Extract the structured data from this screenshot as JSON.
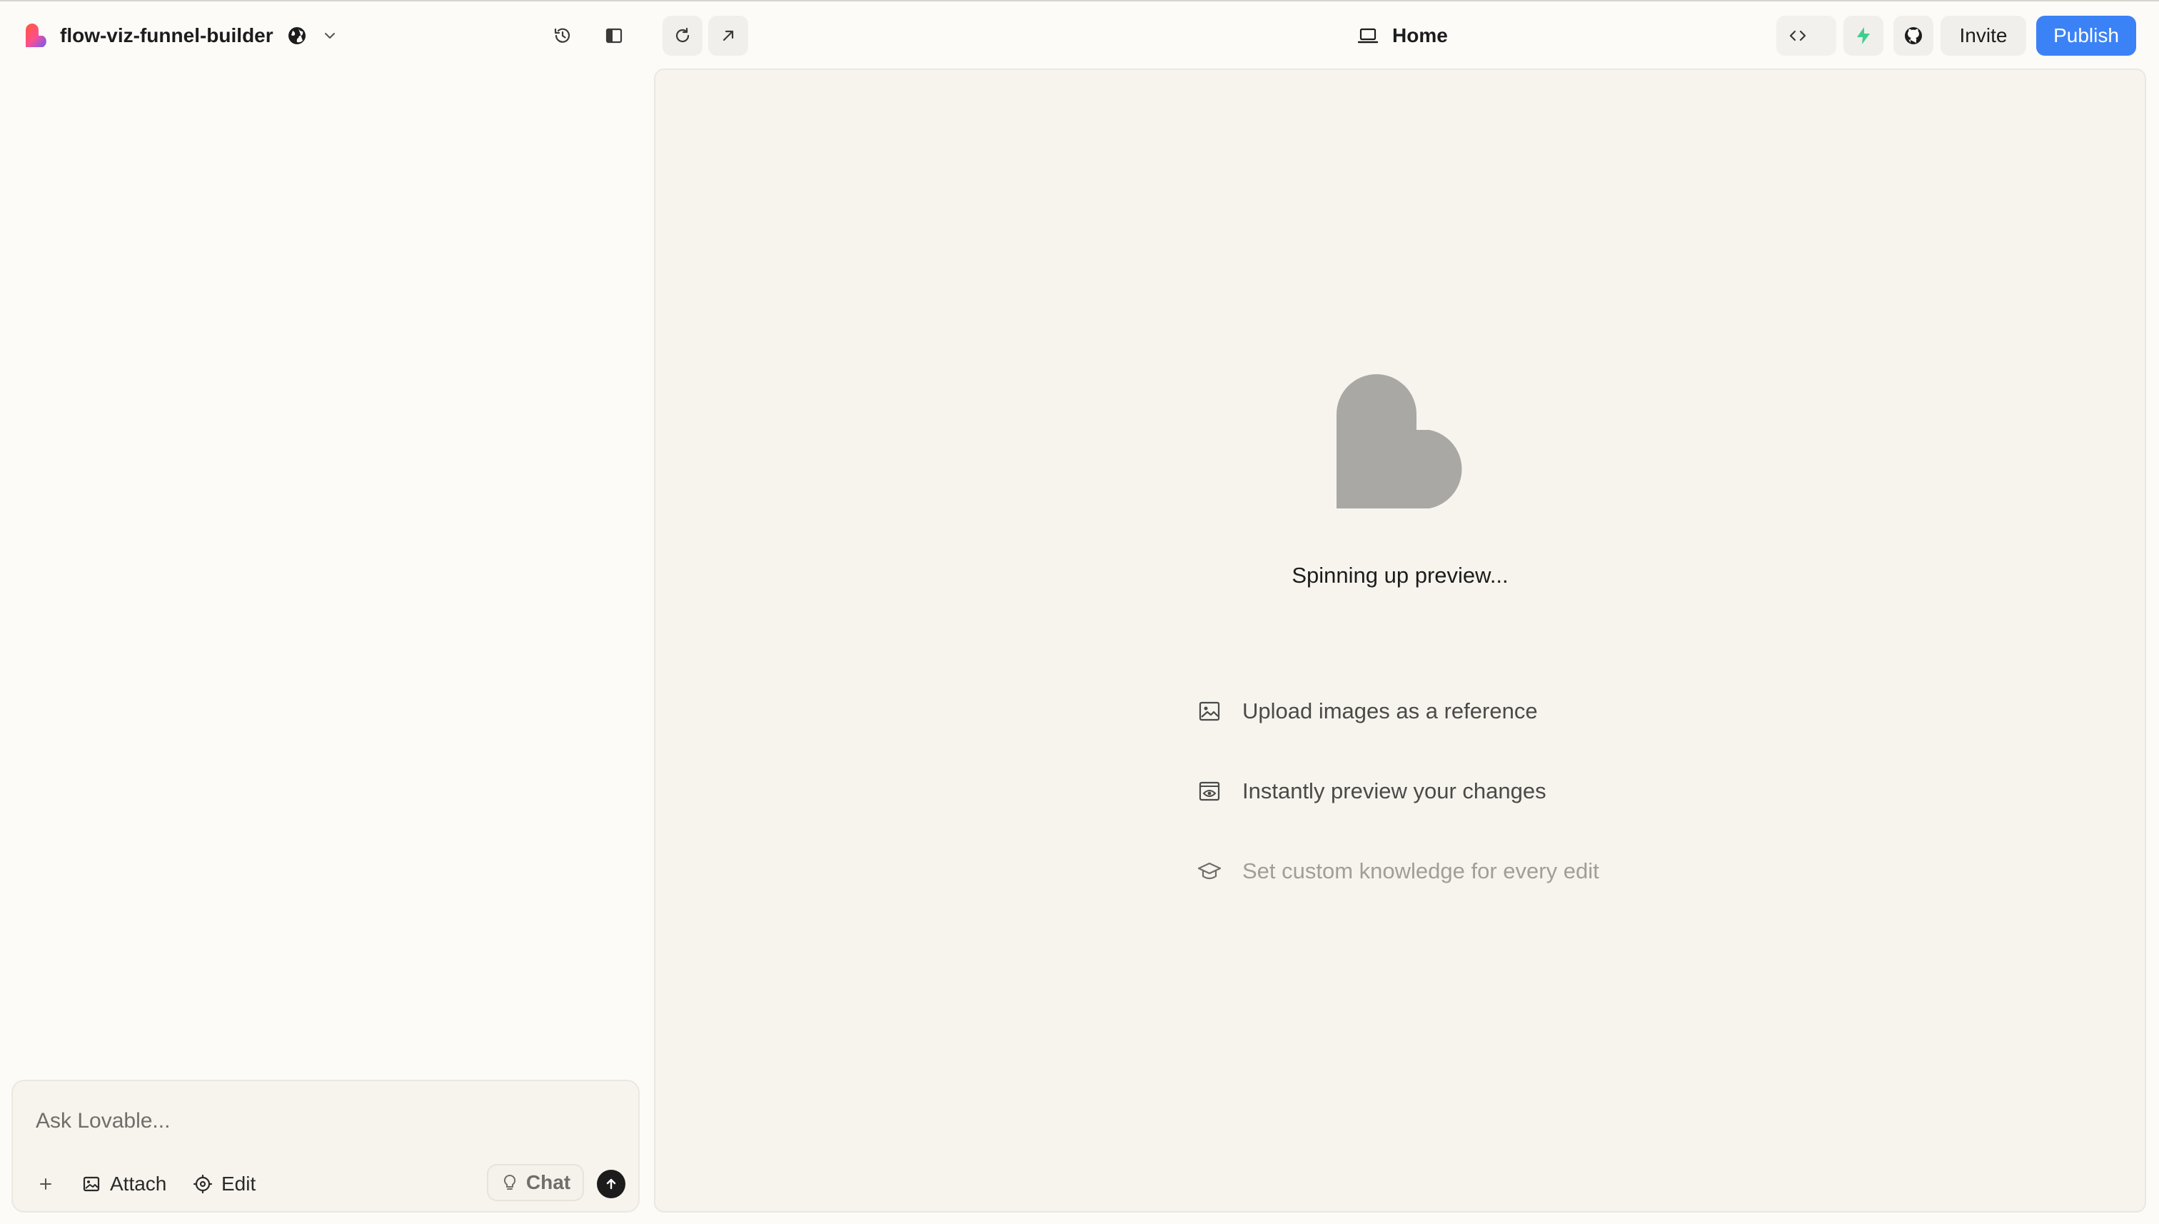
{
  "header": {
    "project_name": "flow-viz-funnel-builder",
    "route_label": "Home",
    "invite_label": "Invite",
    "publish_label": "Publish",
    "icons": [
      "lovable-logo-icon",
      "globe-icon",
      "chevron-down-icon",
      "history-icon",
      "sidebar-toggle-icon",
      "refresh-icon",
      "open-external-icon",
      "laptop-icon",
      "code-icon",
      "supabase-icon",
      "github-icon"
    ]
  },
  "preview": {
    "status_text": "Spinning up preview...",
    "tips": [
      {
        "icon": "image-icon",
        "text": "Upload images as a reference"
      },
      {
        "icon": "eye-icon",
        "text": "Instantly preview your changes"
      },
      {
        "icon": "graduation-cap-icon",
        "text": "Set custom knowledge for every edit"
      }
    ]
  },
  "chat": {
    "placeholder": "Ask Lovable...",
    "attach_label": "Attach",
    "edit_label": "Edit",
    "mode_label": "Chat"
  },
  "colors": {
    "publish_blue": "#3b82f6",
    "supabase_green": "#3ecf8e",
    "heart_gray": "#aaa8a4",
    "panel_bg": "#f7f4ee"
  }
}
